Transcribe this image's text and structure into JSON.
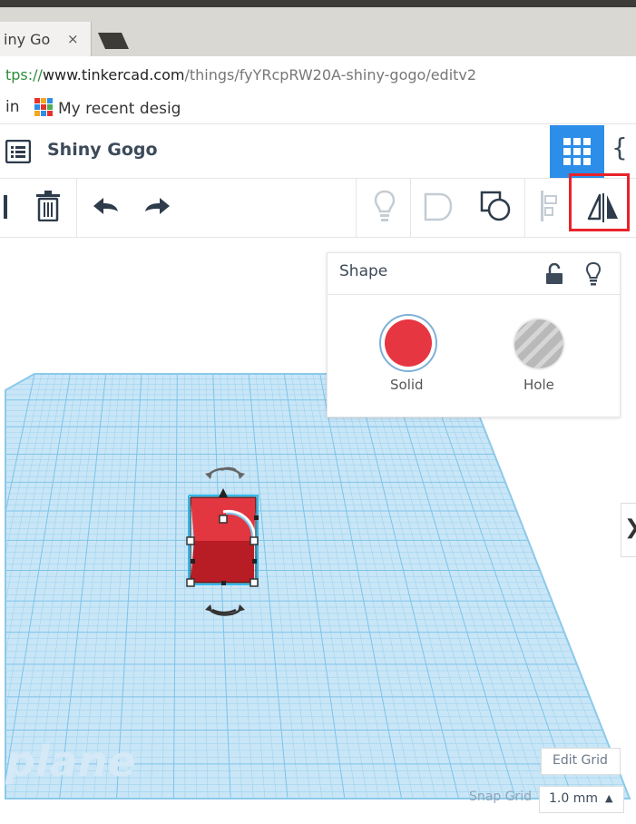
{
  "browser": {
    "tab_title": "iny Go",
    "tab_close": "×",
    "url_proto": "tps://",
    "url_host": "www.tinkercad.com",
    "url_path": "/things/fyYRcpRW20A-shiny-gogo/editv2",
    "bookmark_1": "in",
    "bookmark_2": "My recent desig"
  },
  "app": {
    "project_name": "Shiny Gogo",
    "code_glyph": "{"
  },
  "toolbar": {
    "icons": [
      "menu-list-icon",
      "delete-icon",
      "undo-icon",
      "redo-icon",
      "show-lightbulb-icon",
      "group-icon",
      "ungroup-icon",
      "align-icon",
      "mirror-icon"
    ]
  },
  "shape_panel": {
    "title": "Shape",
    "solid_label": "Solid",
    "hole_label": "Hole",
    "solid_color": "#e63642"
  },
  "workplane": {
    "watermark": "plane",
    "edit_grid_label": "Edit Grid",
    "snap_grid_label": "Snap Grid",
    "snap_grid_value": "1.0 mm",
    "snap_caret": "▲",
    "side_toggle": "❯"
  },
  "colors": {
    "accent": "#2c8ee8",
    "highlight": "#e8232a",
    "grid": "#9fd3ee"
  }
}
